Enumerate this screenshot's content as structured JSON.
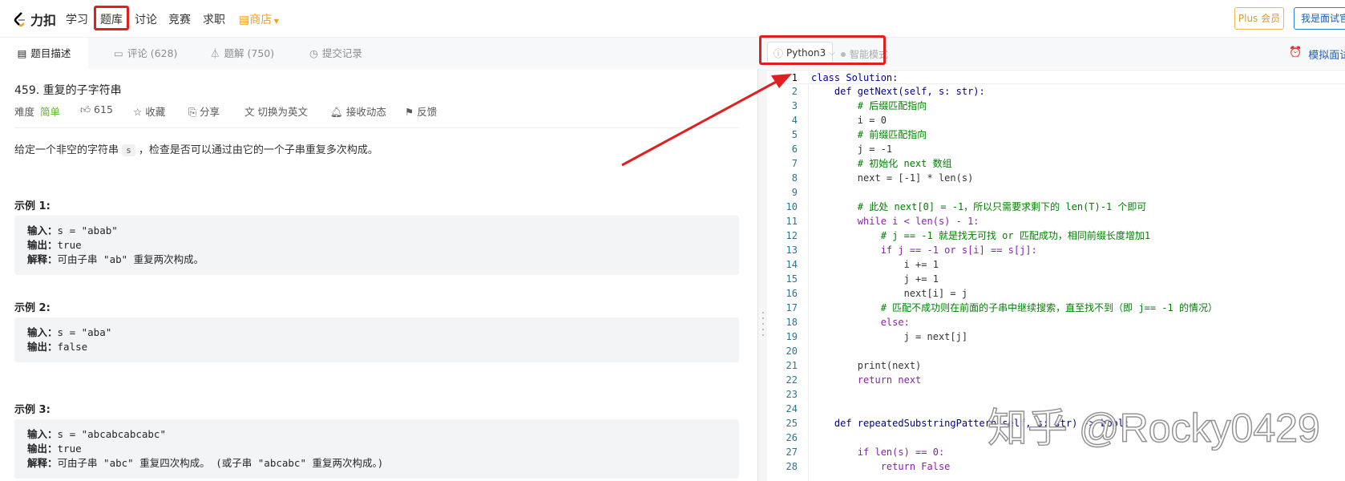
{
  "nav": {
    "logo": "力扣",
    "items": [
      "学习",
      "题库",
      "讨论",
      "竞赛",
      "求职"
    ],
    "shop": "商店",
    "plus": "Plus 会员",
    "interviewer": "我是面试官"
  },
  "tabs": [
    {
      "label": "题目描述"
    },
    {
      "label": "评论 (628)"
    },
    {
      "label": "题解 (750)"
    },
    {
      "label": "提交记录"
    }
  ],
  "toolbar": {
    "language": "Python3",
    "smart_mode": "智能模式",
    "mock_interview": "模拟面试"
  },
  "problem": {
    "title": "459. 重复的子字符串",
    "difficulty_label": "难度",
    "difficulty": "简单",
    "likes": "615",
    "favorite": "收藏",
    "share": "分享",
    "switch_lang": "切换为英文",
    "subscribe": "接收动态",
    "feedback": "反馈",
    "desc_before": "给定一个非空的字符串",
    "desc_code": "s",
    "desc_after": "，检查是否可以通过由它的一个子串重复多次构成。",
    "examples": [
      {
        "heading": "示例 1:",
        "lines": [
          {
            "k": "输入：",
            "v": "s = \"abab\""
          },
          {
            "k": "输出：",
            "v": "true"
          },
          {
            "k": "解释：",
            "v": "可由子串 \"ab\" 重复两次构成。"
          }
        ]
      },
      {
        "heading": "示例 2:",
        "lines": [
          {
            "k": "输入：",
            "v": "s = \"aba\""
          },
          {
            "k": "输出：",
            "v": "false"
          }
        ]
      },
      {
        "heading": "示例 3:",
        "lines": [
          {
            "k": "输入：",
            "v": "s = \"abcabcabcabc\""
          },
          {
            "k": "输出：",
            "v": "true"
          },
          {
            "k": "解释：",
            "v": "可由子串 \"abc\" 重复四次构成。 (或子串 \"abcabc\" 重复两次构成。)"
          }
        ]
      }
    ]
  },
  "code": [
    "class Solution:",
    "    def getNext(self, s: str):",
    "        # 后缀匹配指向",
    "        i = 0",
    "        # 前缀匹配指向",
    "        j = -1",
    "        # 初始化 next 数组",
    "        next = [-1] * len(s)",
    "",
    "        # 此处 next[0] = -1，所以只需要求剩下的 len(T)-1 个即可",
    "        while i < len(s) - 1:",
    "            # j == -1 就是找无可找 or 匹配成功，相同前缀长度增加1",
    "            if j == -1 or s[i] == s[j]:",
    "                i += 1",
    "                j += 1",
    "                next[i] = j",
    "            # 匹配不成功则在前面的子串中继续搜索，直至找不到（即 j== -1 的情况）",
    "            else:",
    "                j = next[j]",
    "",
    "        print(next)",
    "        return next",
    "",
    "",
    "    def repeatedSubstringPattern(self, s: str) -> bool:",
    "",
    "        if len(s) == 0:",
    "            return False"
  ],
  "watermark": "知乎 @Rocky0429",
  "colors": {
    "accent_red": "#e02020",
    "shop": "#f0a020",
    "easy": "#5ab726",
    "link": "#2060b0"
  }
}
